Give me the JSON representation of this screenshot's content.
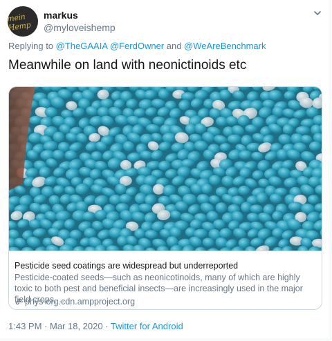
{
  "author": {
    "name": "markus",
    "handle": "@myloveishemp",
    "avatar_text": "mein Hemp"
  },
  "reply": {
    "prefix": "Replying to ",
    "user1": "@TheGAAIA",
    "user2": "@FerdOwner",
    "conj": " and ",
    "user3": "@WeAreBenchmark"
  },
  "tweet": {
    "text": "Meanwhile on land with neonictinoids etc"
  },
  "card": {
    "image_alt": "pile of blue pesticide-coated seeds",
    "title": "Pesticide seed coatings are widespread but underreported",
    "description": "Pesticide-coated seeds—such as neonicotinoids, many of which are highly toxic to both pest and beneficial insects—are increasingly used in the major field crops, …",
    "link": "phys-org.cdn.ampproject.org"
  },
  "meta": {
    "time": "1:43 PM",
    "sep": " · ",
    "date": "Mar 18, 2020",
    "source": "Twitter for Android"
  },
  "colors": {
    "link": "#1b95e0",
    "secondary": "#657786",
    "seed": "#3aa6c2"
  },
  "icons": [
    "chevron-down-icon",
    "link-icon"
  ]
}
